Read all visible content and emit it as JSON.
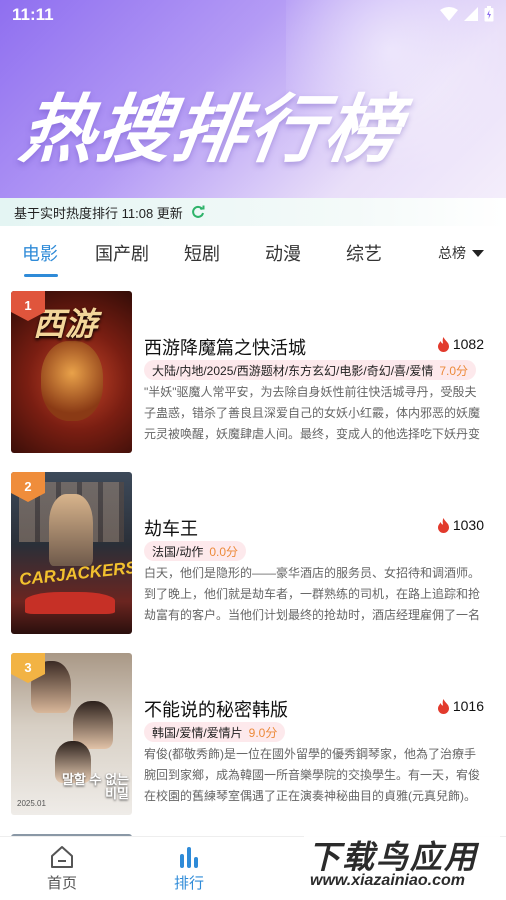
{
  "status_bar": {
    "time": "11:11"
  },
  "header": {
    "title": "热搜排行榜"
  },
  "update_bar": {
    "text": "基于实时热度排行 11:08 更新"
  },
  "tabs": [
    {
      "label": "电影",
      "active": true
    },
    {
      "label": "国产剧"
    },
    {
      "label": "短剧"
    },
    {
      "label": "动漫"
    },
    {
      "label": "综艺"
    }
  ],
  "sort": {
    "label": "总榜"
  },
  "items": [
    {
      "rank": "1",
      "title": "西游降魔篇之快活城",
      "heat": "1082",
      "tags": "大陆/内地/2025/西游题材/东方玄幻/电影/奇幻/喜/爱情",
      "score": "7.0分",
      "desc": "\"半妖\"驱魔人常平安，为去除自身妖性前往快活城寻丹，受殷夫子蛊惑，错杀了善良且深爱自己的女妖小红霰，体内邪恶的妖魔元灵被唤醒，妖魔肆虐人间。最终，变成人的他选择吃下妖丹变成妖，携手…",
      "poster_text": "西游"
    },
    {
      "rank": "2",
      "title": "劫车王",
      "heat": "1030",
      "tags": "法国/动作",
      "score": "0.0分",
      "desc": "白天，他们是隐形的——豪华酒店的服务员、女招待和调酒师。到了晚上，他们就是劫车者，一群熟练的司机，在路上追踪和抢劫富有的客户。当他们计划最终的抢劫时，酒店经理雇佣了一名无情的杀手…",
      "poster_text": "CARJACKERS"
    },
    {
      "rank": "3",
      "title": "不能说的秘密韩版",
      "heat": "1016",
      "tags": "韩国/爱情/爱情片",
      "score": "9.0分",
      "desc": "宥俊(都敬秀飾)是一位在國外留學的優秀鋼琴家，他為了治療手腕回到家鄉，成為韓國一所音樂學院的交換學生。有一天，宥俊在校園的舊練琴室偶遇了正在演奏神秘曲目的貞雅(元真兒飾)。陪著他們相…",
      "poster_text": "말할 수 없는 비밀",
      "poster_date": "2025.01"
    }
  ],
  "bottom_nav": [
    {
      "label": "首页"
    },
    {
      "label": "排行",
      "active": true
    }
  ],
  "watermark": {
    "title": "下载鸟应用",
    "url": "www.xiazainiao.com"
  },
  "colors": {
    "accent": "#2f8bd8",
    "header_start": "#8f6ff0",
    "fire": "#e23a2c",
    "score": "#ec8a3a",
    "tag_bg": "#fde9ec",
    "rank1": "#e0553c",
    "rank2": "#ef8d3b",
    "rank3": "#f2b344"
  }
}
